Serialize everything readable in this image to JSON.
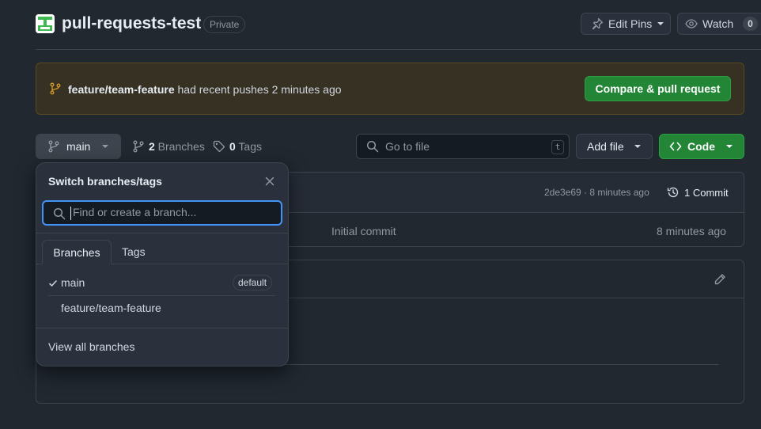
{
  "repo": {
    "name": "pull-requests-test",
    "visibility": "Private"
  },
  "header_actions": {
    "edit_pins": "Edit Pins",
    "watch": "Watch",
    "watch_count": "0"
  },
  "banner": {
    "branch": "feature/team-feature",
    "message": " had recent pushes 2 minutes ago",
    "action": "Compare & pull request"
  },
  "toolbar": {
    "current_branch": "main",
    "branches_count": "2",
    "branches_label": " Branches",
    "tags_count": "0",
    "tags_label": " Tags",
    "goto_placeholder": "Go to file",
    "goto_shortcut": "t",
    "add_file": "Add file",
    "code": "Code"
  },
  "commit": {
    "hash_time": "2de3e69 · 8 minutes ago",
    "count_label": "1 Commit",
    "row_message": "Initial commit",
    "row_time": "8 minutes ago"
  },
  "branch_popover": {
    "title": "Switch branches/tags",
    "search_placeholder": "Find or create a branch...",
    "tabs": [
      "Branches",
      "Tags"
    ],
    "branches": [
      {
        "name": "main",
        "badge": "default",
        "selected": true
      },
      {
        "name": "feature/team-feature",
        "badge": "",
        "selected": false
      }
    ],
    "footer_link": "View all branches"
  },
  "colors": {
    "background": "#212830",
    "accent_blue": "#4493f8",
    "primary_green": "#238636",
    "banner_bg": "#363123",
    "banner_icon": "#d29922"
  }
}
